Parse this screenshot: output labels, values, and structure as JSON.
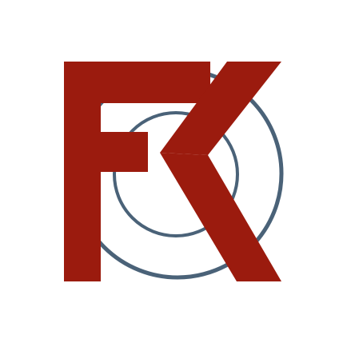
{
  "logo": {
    "monogram": "FK",
    "colors": {
      "background": "#ffffff",
      "letters": "#9b1b0e",
      "rings": "#4a6278"
    }
  }
}
